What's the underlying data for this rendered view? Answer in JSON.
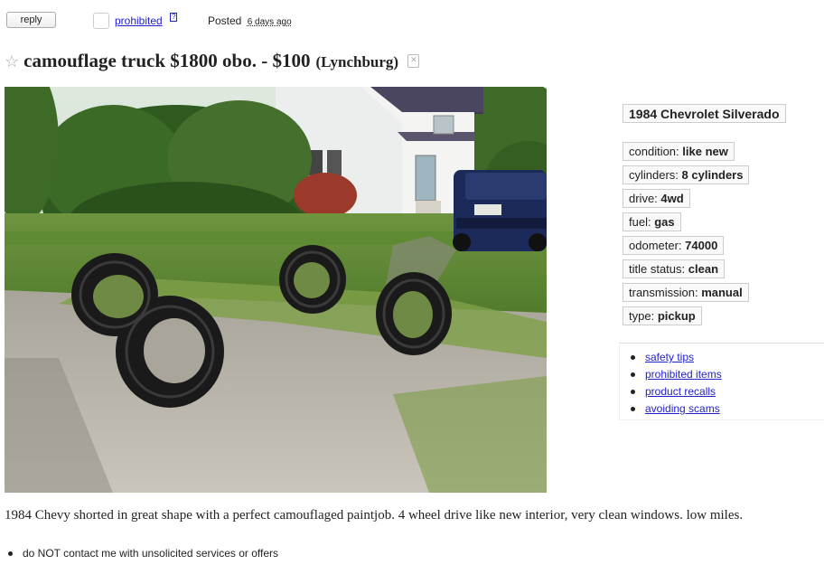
{
  "actions": {
    "reply_label": "reply",
    "prohibited_label": "prohibited",
    "help_label": "?",
    "posted_label": "Posted",
    "posted_time": "6 days ago"
  },
  "posting": {
    "title": "camouflage truck $1800 obo. - $100",
    "location": "(Lynchburg)",
    "body": "1984 Chevy shorted in great shape with a perfect camouflaged paintjob. 4 wheel drive like new interior, very clean windows. low miles.",
    "notice": "do NOT contact me with unsolicited services or offers"
  },
  "attributes": {
    "title": "1984 Chevrolet Silverado",
    "items": [
      {
        "label": "condition:",
        "value": "like new"
      },
      {
        "label": "cylinders:",
        "value": "8 cylinders"
      },
      {
        "label": "drive:",
        "value": "4wd"
      },
      {
        "label": "fuel:",
        "value": "gas"
      },
      {
        "label": "odometer:",
        "value": "74000"
      },
      {
        "label": "title status:",
        "value": "clean"
      },
      {
        "label": "transmission:",
        "value": "manual"
      },
      {
        "label": "type:",
        "value": "pickup"
      }
    ]
  },
  "safety_links": [
    "safety tips",
    "prohibited items",
    "product recalls",
    "avoiding scams"
  ],
  "icons": {
    "favorite": "star-icon",
    "hide": "hide-icon"
  },
  "colors": {
    "link": "#2222cc"
  }
}
